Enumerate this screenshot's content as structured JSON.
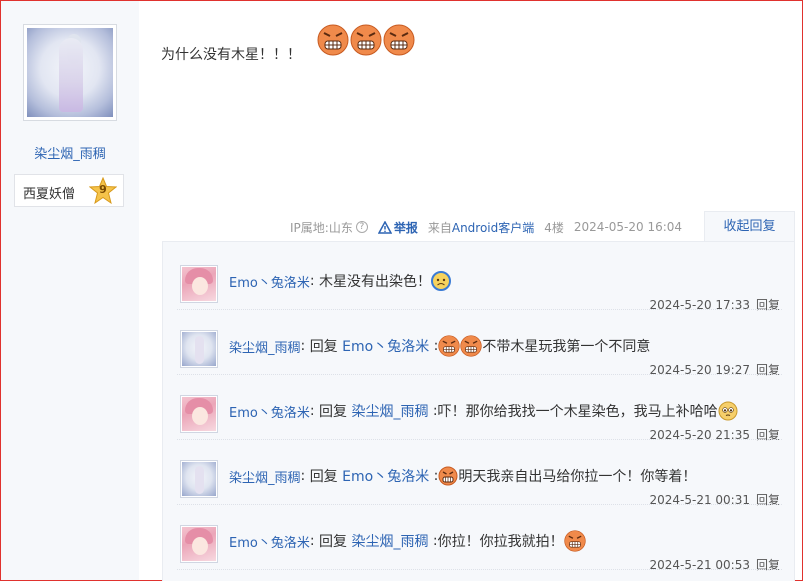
{
  "author": {
    "name": "染尘烟_雨稠",
    "badge_text": "西夏妖僧",
    "badge_level": "9"
  },
  "post": {
    "text": "为什么没有木星！！！",
    "emojis": [
      "angry-face-icon",
      "angry-face-icon",
      "angry-face-icon"
    ]
  },
  "meta": {
    "ip": "IP属地:山东",
    "report": "举报",
    "source_prefix": "来自",
    "source_client": "Android客户端",
    "floor": "4楼",
    "time": "2024-05-20 16:04",
    "collapse": "收起回复"
  },
  "replies": [
    {
      "user": "Emo丶兔洛米",
      "sep": ":",
      "reply_prefix": "",
      "reply_to": "",
      "reply_colon": "",
      "text_before": "木星没有出染色！",
      "text_after": "",
      "emoji": "sad-face-icon",
      "emoji_position": "after",
      "time": "2024-5-20 17:33",
      "reply_label": "回复"
    },
    {
      "user": "染尘烟_雨稠",
      "sep": ":",
      "reply_prefix": "回复",
      "reply_to": "Emo丶兔洛米",
      "reply_colon": ":",
      "text_before": "",
      "text_after": "不带木星玩我第一个不同意",
      "emoji": "angry-face-icon-x2",
      "emoji_position": "before",
      "time": "2024-5-20 19:27",
      "reply_label": "回复"
    },
    {
      "user": "Emo丶兔洛米",
      "sep": ":",
      "reply_prefix": "回复",
      "reply_to": "染尘烟_雨稠",
      "reply_colon": ":",
      "text_before": "吓！那你给我找一个木星染色，我马上补哈哈",
      "text_after": "",
      "emoji": "pleading-face-icon",
      "emoji_position": "after",
      "time": "2024-5-20 21:35",
      "reply_label": "回复"
    },
    {
      "user": "染尘烟_雨稠",
      "sep": ":",
      "reply_prefix": "回复",
      "reply_to": "Emo丶兔洛米",
      "reply_colon": ":",
      "text_before": "",
      "text_after": "明天我亲自出马给你拉一个！你等着！",
      "emoji": "grin-face-icon",
      "emoji_position": "before",
      "time": "2024-5-21 00:31",
      "reply_label": "回复"
    },
    {
      "user": "Emo丶兔洛米",
      "sep": ":",
      "reply_prefix": "回复",
      "reply_to": "染尘烟_雨稠",
      "reply_colon": ":",
      "text_before": "你拉！你拉我就拍！",
      "text_after": "",
      "emoji": "angry-face-icon",
      "emoji_position": "after",
      "time": "2024-5-21 00:53",
      "reply_label": "回复"
    }
  ]
}
